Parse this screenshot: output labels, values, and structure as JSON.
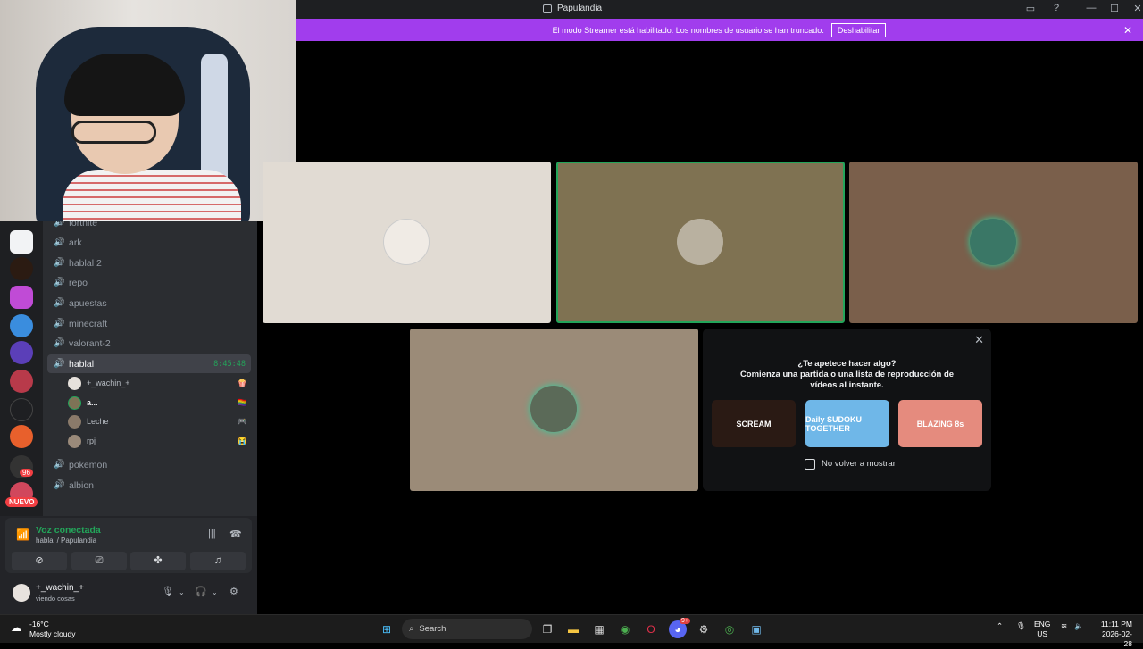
{
  "window": {
    "title": "Papulandia",
    "controls": [
      "—",
      "☐",
      "✕"
    ]
  },
  "banner": {
    "text": "El modo Streamer está habilitado. Los nombres de usuario se han truncado.",
    "button": "Deshabilitar"
  },
  "channels": {
    "list": [
      {
        "name": "fortnite"
      },
      {
        "name": "ark"
      },
      {
        "name": "hablal 2"
      },
      {
        "name": "repo"
      },
      {
        "name": "apuestas"
      },
      {
        "name": "minecraft"
      },
      {
        "name": "valorant-2"
      },
      {
        "name": "hablal",
        "timer": "8:45:48",
        "active": true
      },
      {
        "name": "pokemon"
      },
      {
        "name": "albion"
      }
    ],
    "members": [
      {
        "name": "+_wachin_+",
        "emoji": "🍿"
      },
      {
        "name": "a...",
        "emoji": "🏳️‍🌈"
      },
      {
        "name": "Leche",
        "emoji": "🎮"
      },
      {
        "name": "rpj",
        "emoji": "😭"
      }
    ]
  },
  "servers": {
    "new_badge": "NUEVO",
    "count_badge": "96"
  },
  "voice": {
    "status": "Voz conectada",
    "location": "hablal / Papulandia"
  },
  "user": {
    "name": "+_wachin_+",
    "status": "viendo cosas"
  },
  "activity": {
    "question": "¿Te apetece hacer algo?",
    "description": "Comienza una partida o una lista de reproducción de vídeos al instante.",
    "games": [
      {
        "name": "SCREAM",
        "color": "#2a1a14"
      },
      {
        "name": "Daily SUDOKU TOGETHER",
        "color": "#6fb7e8"
      },
      {
        "name": "BLAZING 8s",
        "color": "#e58b7e"
      }
    ],
    "checkbox_label": "No volver a mostrar"
  },
  "taskbar": {
    "temperature": "-16°C",
    "weather": "Mostly cloudy",
    "search": "Search",
    "lang1": "ENG",
    "lang2": "US",
    "time": "11:11 PM",
    "date": "2026-02-28",
    "discord_badge": "9+"
  },
  "colors": {
    "accent_green": "#23a55a",
    "banner_purple": "#a13ded"
  }
}
